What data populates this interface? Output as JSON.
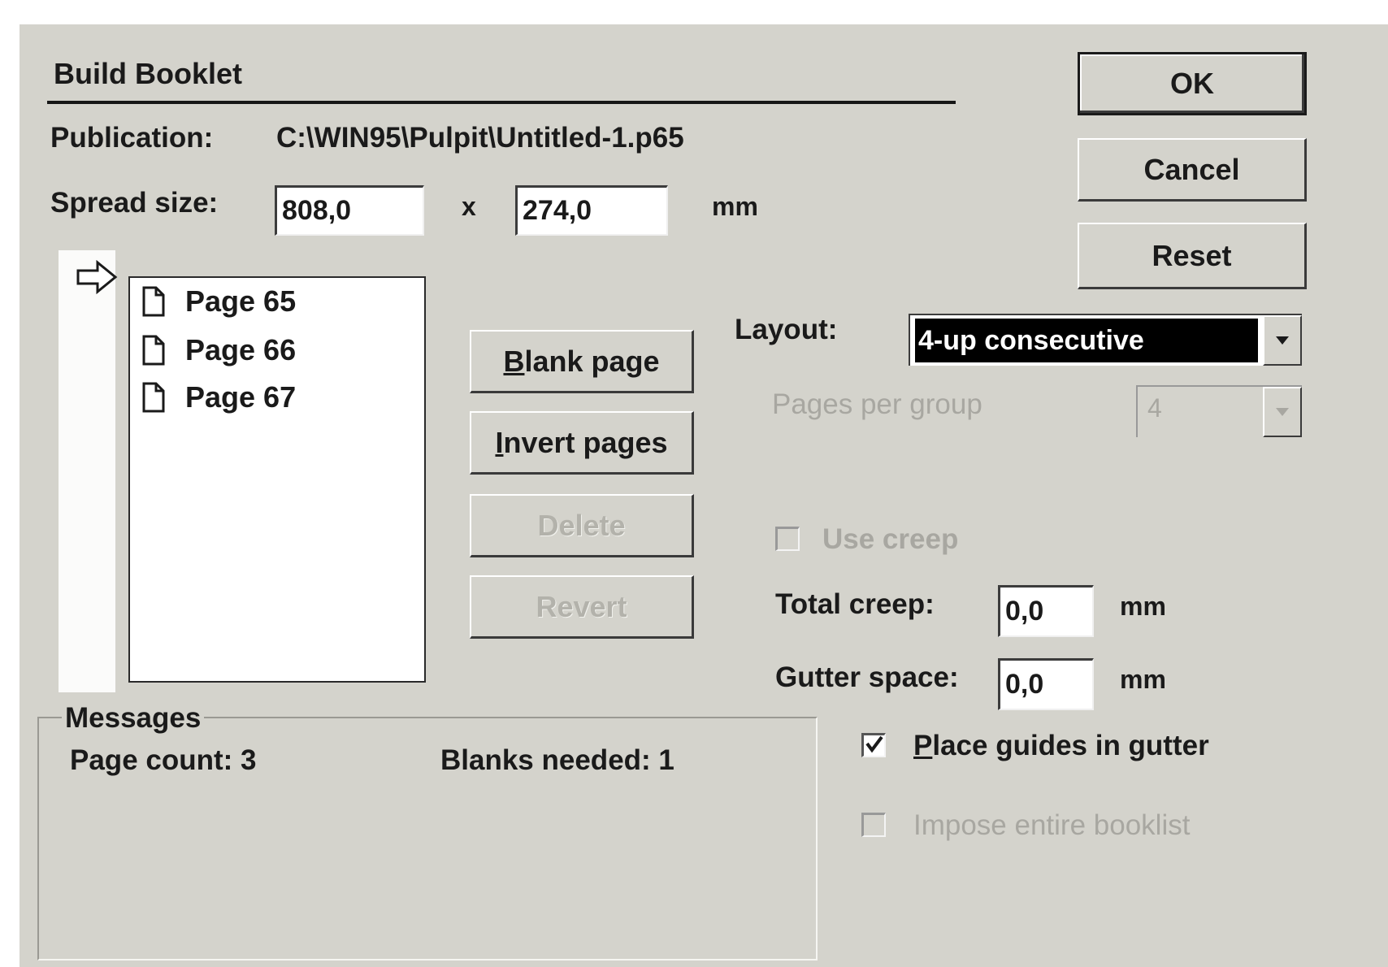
{
  "dialog": {
    "title": "Build Booklet",
    "publication_label": "Publication:",
    "publication_path": "C:\\WIN95\\Pulpit\\Untitled-1.p65",
    "spread_label": "Spread size:",
    "spread_width": "808,0",
    "spread_x": "x",
    "spread_height": "274,0",
    "spread_unit": "mm"
  },
  "buttons": {
    "ok": "OK",
    "cancel": "Cancel",
    "reset": "Reset",
    "blank_page_first": "B",
    "blank_page_rest": "lank page",
    "invert_first": "I",
    "invert_rest": "nvert pages",
    "delete": "Delete",
    "revert": "Revert"
  },
  "pages": [
    {
      "label": "Page 65"
    },
    {
      "label": "Page 66"
    },
    {
      "label": "Page 67"
    }
  ],
  "layout": {
    "label": "Layout:",
    "selected": "4-up consecutive",
    "pages_per_group_label": "Pages per group",
    "pages_per_group_value": "4"
  },
  "creep": {
    "use_creep_label": "Use creep",
    "use_creep_checked": false,
    "total_label": "Total creep:",
    "total_value": "0,0",
    "total_unit": "mm",
    "gutter_label": "Gutter space:",
    "gutter_value": "0,0",
    "gutter_unit": "mm"
  },
  "options": {
    "place_guides_first": "P",
    "place_guides_rest": "lace guides in gutter",
    "place_guides_checked": true,
    "impose_label": "Impose entire booklist",
    "impose_checked": false
  },
  "messages": {
    "title": "Messages",
    "page_count": "Page count: 3",
    "blanks_needed": "Blanks needed: 1"
  },
  "icons": [
    "arrow-right-icon",
    "document-icon",
    "chevron-down-icon",
    "checkmark-icon"
  ]
}
